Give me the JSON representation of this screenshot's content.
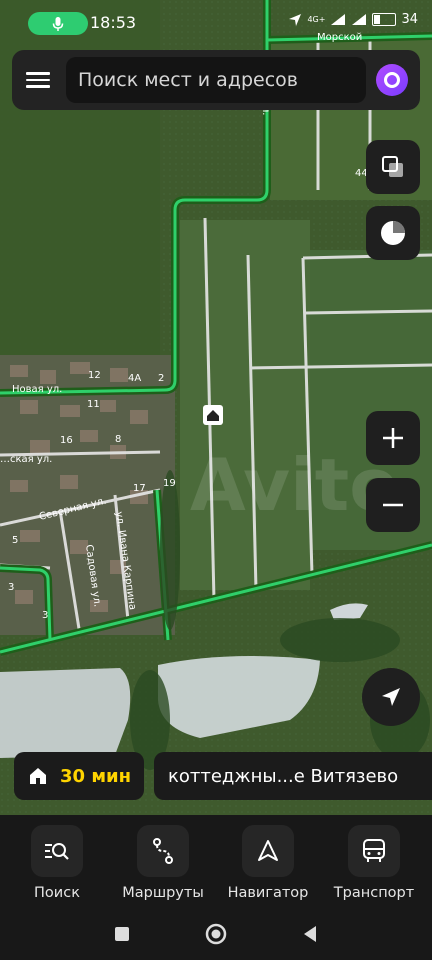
{
  "status_bar": {
    "time": "18:53",
    "network": "4G+",
    "battery": "34"
  },
  "search": {
    "placeholder": "Поиск мест и адресов"
  },
  "map": {
    "town_label": "Морской",
    "house_numbers": [
      "12",
      "4А",
      "2",
      "11",
      "16",
      "8",
      "17",
      "19",
      "5",
      "3",
      "3",
      "44"
    ],
    "streets": [
      "Новая ул.",
      "Северная ул.",
      "Садовая ул.",
      "ул. Ивана Карпина",
      "ул.",
      "…ская ул."
    ],
    "watermark": "Avito"
  },
  "route_summary": {
    "duration": "30 мин",
    "destination": "коттеджны...е Витязево"
  },
  "bottom_nav": {
    "items": [
      {
        "label": "Поиск",
        "icon": "search-list-icon"
      },
      {
        "label": "Маршруты",
        "icon": "routes-icon"
      },
      {
        "label": "Навигатор",
        "icon": "navigator-icon"
      },
      {
        "label": "Транспорт",
        "icon": "bus-icon"
      }
    ]
  },
  "colors": {
    "route_green": "#2fd06a",
    "accent_yellow": "#ffd400",
    "alice_purple": "#8a3dff"
  }
}
